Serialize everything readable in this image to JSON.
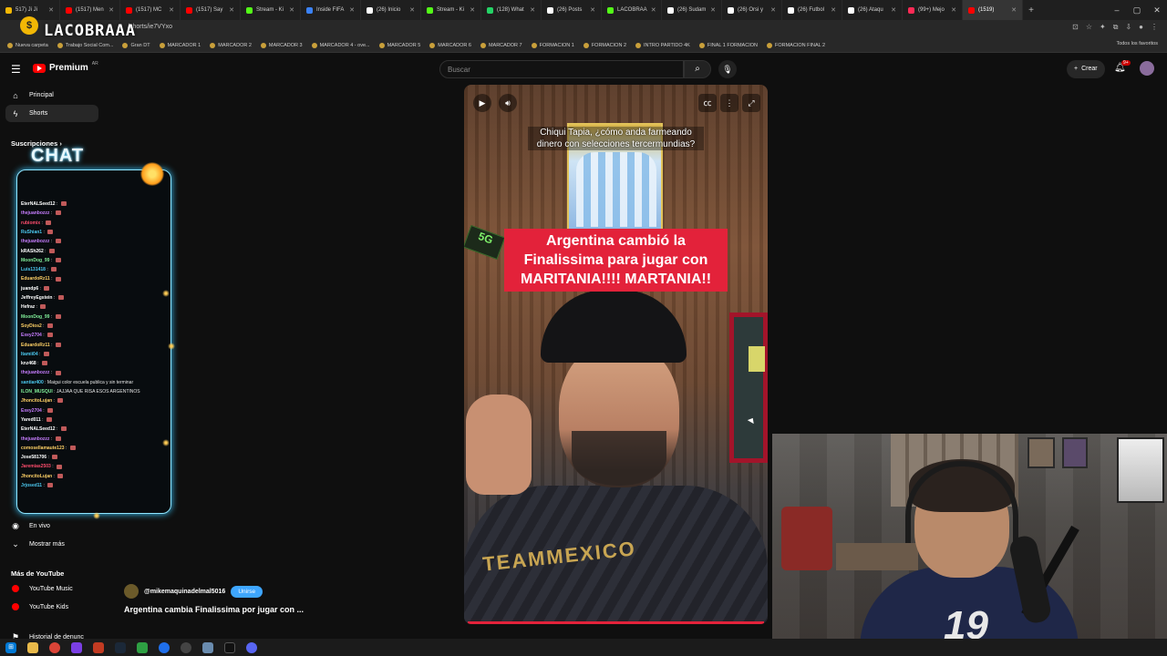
{
  "browser": {
    "tabs": [
      {
        "label": "517) Ji Ji",
        "color": "#f2b705"
      },
      {
        "label": "(1517) Men",
        "color": "#ff0000"
      },
      {
        "label": "(1517) MC",
        "color": "#ff0000"
      },
      {
        "label": "(1517) Say",
        "color": "#ff0000"
      },
      {
        "label": "Stream - Ki",
        "color": "#53fc18"
      },
      {
        "label": "Inside FIFA",
        "color": "#3b82f6"
      },
      {
        "label": "(26) Inicio",
        "color": "#ffffff"
      },
      {
        "label": "Stream - Ki",
        "color": "#53fc18"
      },
      {
        "label": "(128) What",
        "color": "#25d366"
      },
      {
        "label": "(26) Posts",
        "color": "#ffffff"
      },
      {
        "label": "LACOBRAA",
        "color": "#53fc18"
      },
      {
        "label": "(26) Sudam",
        "color": "#ffffff"
      },
      {
        "label": "(26) Orsi y",
        "color": "#ffffff"
      },
      {
        "label": "(26) Futbol",
        "color": "#ffffff"
      },
      {
        "label": "(26) Ataqu",
        "color": "#ffffff"
      },
      {
        "label": "(99+) Mejo",
        "color": "#ff2a55"
      },
      {
        "label": "(1519)",
        "color": "#ff0000"
      }
    ],
    "active_tab_index": 16,
    "url_text": "/shorts/ie7VYxo",
    "bookmarks": [
      "Nueva carpeta",
      "Trabajo Social Com...",
      "Gran DT",
      "MARCADOR 1",
      "MARCADOR 2",
      "MARCADOR 3",
      "MARCADOR 4 - ove...",
      "MARCADOR 5",
      "MARCADOR 6",
      "MARCADOR 7",
      "FORMACION 1",
      "FORMACION 2",
      "INTRO PARTIDO 4K",
      "FINAL 1 FORMACION",
      "FORMACION FINAL 2"
    ],
    "bookmarks_all": "Todos los favoritos"
  },
  "overlay": {
    "logo_text": "LACOBRAAA"
  },
  "youtube": {
    "logo_text": "Premium",
    "logo_country": "AR",
    "search_placeholder": "Buscar",
    "create_label": "Crear",
    "notification_count": "9+",
    "sidebar": {
      "principal": "Principal",
      "shorts": "Shorts",
      "subscriptions_header": "Suscripciones",
      "en_vivo": "En vivo",
      "mostrar_mas": "Mostrar más",
      "mas_de_youtube": "Más de YouTube",
      "youtube_music": "YouTube Music",
      "youtube_kids": "YouTube Kids",
      "historial": "Historial de denunc"
    }
  },
  "chat": {
    "title": "CHAT",
    "messages": [
      {
        "user": "EterNALSeed12",
        "color": "#ffffff",
        "text": ""
      },
      {
        "user": "thejuanbozzz",
        "color": "#c77dff",
        "text": ""
      },
      {
        "user": "rubiomix",
        "color": "#ff4d6d",
        "text": ""
      },
      {
        "user": "RuShian1",
        "color": "#4cc9f0",
        "text": ""
      },
      {
        "user": "thejuanbozzz",
        "color": "#c77dff",
        "text": ""
      },
      {
        "user": "kRASh262",
        "color": "#ffffff",
        "text": ""
      },
      {
        "user": "MoonDog_99",
        "color": "#80ed99",
        "text": ""
      },
      {
        "user": "Luis131418",
        "color": "#4cc9f0",
        "text": ""
      },
      {
        "user": "EduardoRz11",
        "color": "#ffd166",
        "text": ""
      },
      {
        "user": "juandp6",
        "color": "#ffffff",
        "text": ""
      },
      {
        "user": "JeffreyEgstein",
        "color": "#ffffff",
        "text": ""
      },
      {
        "user": "Hefraz",
        "color": "#ffffff",
        "text": ""
      },
      {
        "user": "MoonDog_99",
        "color": "#80ed99",
        "text": ""
      },
      {
        "user": "SoyDios2",
        "color": "#ffd166",
        "text": ""
      },
      {
        "user": "Exey2704",
        "color": "#c77dff",
        "text": ""
      },
      {
        "user": "EduardoRz11",
        "color": "#ffd166",
        "text": ""
      },
      {
        "user": "Itamii04",
        "color": "#4cc9f0",
        "text": ""
      },
      {
        "user": "knz468",
        "color": "#ffffff",
        "text": ""
      },
      {
        "user": "thejuanbozzz",
        "color": "#c77dff",
        "text": ""
      },
      {
        "user": "santiar400",
        "color": "#4cc9f0",
        "text": "Maigui color escuela publica y sin terminar"
      },
      {
        "user": "ILON_MUSQUI",
        "color": "#80ed99",
        "text": "JAJJAA QUE RISA ESOS ARGENTINOS"
      },
      {
        "user": "JhoncitoLujan",
        "color": "#ffd166",
        "text": ""
      },
      {
        "user": "Exey2704",
        "color": "#c77dff",
        "text": ""
      },
      {
        "user": "Yared011",
        "color": "#ffffff",
        "text": ""
      },
      {
        "user": "EterNALSeed12",
        "color": "#ffffff",
        "text": ""
      },
      {
        "user": "thejuanbozzz",
        "color": "#c77dff",
        "text": ""
      },
      {
        "user": "comosellamaute123",
        "color": "#ffd166",
        "text": ""
      },
      {
        "user": "Jose581706",
        "color": "#ffffff",
        "text": ""
      },
      {
        "user": "Jaremias2503",
        "color": "#ff4d6d",
        "text": ""
      },
      {
        "user": "JhoncitoLujan",
        "color": "#ffd166",
        "text": ""
      },
      {
        "user": "Jrjosed11",
        "color": "#4cc9f0",
        "text": ""
      }
    ]
  },
  "video": {
    "caption_top": "Chiqui Tapia, ¿cómo anda farmeando dinero con selecciones tercermundias?",
    "caption_main": "Argentina cambió la Finalissima para jugar con MARITANIA!!!! MARTANIA!!",
    "shirt_text": "TEAMMEXICO",
    "sign_text": "5G"
  },
  "channel": {
    "name": "@mikemaquinadelmal5016",
    "join_label": "Unirse",
    "video_title": "Argentina cambia Finalissima por jugar con ..."
  },
  "webcam": {
    "jersey_number": "19"
  }
}
